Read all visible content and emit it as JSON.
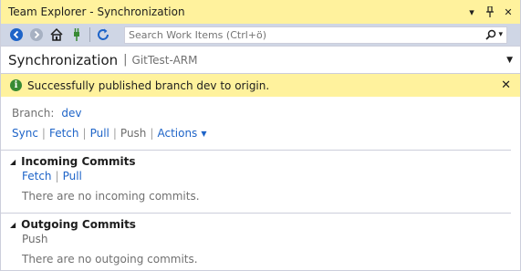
{
  "window": {
    "title": "Team Explorer - Synchronization"
  },
  "titlebar_controls": {
    "dropdown": "▾",
    "pin": "⊥",
    "close": "✕"
  },
  "toolbar": {
    "search_placeholder": "Search Work Items (Ctrl+ö)"
  },
  "header": {
    "title": "Synchronization",
    "separator": "|",
    "subtitle": "GitTest-ARM"
  },
  "notification": {
    "icon_glyph": "i",
    "message": "Successfully published branch dev to origin.",
    "close": "✕"
  },
  "branch": {
    "label": "Branch:",
    "value": "dev"
  },
  "actions": {
    "sync": "Sync",
    "fetch": "Fetch",
    "pull": "Pull",
    "push": "Push",
    "actions_menu": "Actions",
    "sep": "|"
  },
  "incoming": {
    "title": "Incoming Commits",
    "fetch": "Fetch",
    "pull": "Pull",
    "sep": "|",
    "empty": "There are no incoming commits."
  },
  "outgoing": {
    "title": "Outgoing Commits",
    "push": "Push",
    "empty": "There are no outgoing commits."
  },
  "colors": {
    "titlebar_bg": "#fff29d",
    "toolbar_bg": "#cfd6e5",
    "link": "#1e64c8",
    "info_green": "#388a34"
  }
}
